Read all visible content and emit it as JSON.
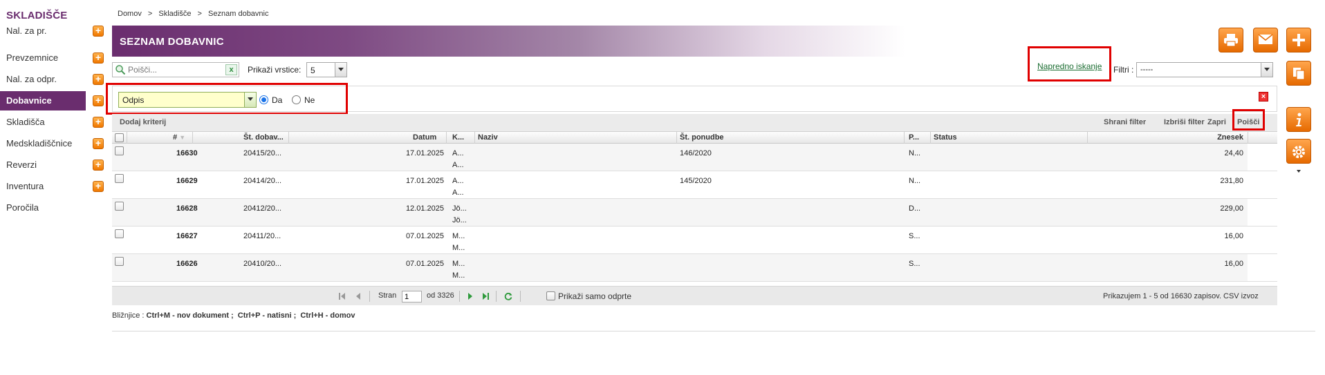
{
  "sidebar": {
    "title": "SKLADIŠČE",
    "items": [
      {
        "label": "Nal. za pr.",
        "add": true
      },
      {
        "label": "Prevzemnice",
        "add": true
      },
      {
        "label": "Nal. za odpr.",
        "add": true
      },
      {
        "label": "Dobavnice",
        "add": true,
        "active": true
      },
      {
        "label": "Skladišča",
        "add": true
      },
      {
        "label": "Medskladiščnice",
        "add": true
      },
      {
        "label": "Reverzi",
        "add": true
      },
      {
        "label": "Inventura",
        "add": true
      },
      {
        "label": "Poročila",
        "add": false
      }
    ]
  },
  "breadcrumb": [
    "Domov",
    ">",
    "Skladišče",
    ">",
    "Seznam dobavnic"
  ],
  "header": {
    "title": "SEZNAM DOBAVNIC"
  },
  "search": {
    "placeholder": "Poišči...",
    "clear_icon": "x"
  },
  "rows": {
    "label": "Prikaži vrstice:",
    "value": "5"
  },
  "advanced": {
    "label": "Napredno iskanje"
  },
  "filters": {
    "label": "Filtri :",
    "value": "-----"
  },
  "criteria": {
    "field_value": "Odpis",
    "option_yes": "Da",
    "option_no": "Ne",
    "selected": "Da"
  },
  "toolbar": {
    "add_criteria": "Dodaj kriterij",
    "save_filter": "Shrani filter",
    "delete_filter": "Izbriši filter",
    "close": "Zapri",
    "search": "Poišči"
  },
  "table": {
    "headers": {
      "num": "#",
      "doc_no": "Št. dobav...",
      "date": "Datum",
      "k": "K...",
      "name": "Naziv",
      "offer_no": "Št. ponudbe",
      "p": "P...",
      "status": "Status",
      "amount": "Znesek"
    },
    "rows": [
      {
        "num": "16630",
        "doc_no": "20415/20...",
        "date": "17.01.2025",
        "k1": "A...",
        "k2": "A...",
        "offer_no": "146/2020",
        "p": "N...",
        "amount": "24,40"
      },
      {
        "num": "16629",
        "doc_no": "20414/20...",
        "date": "17.01.2025",
        "k1": "A...",
        "k2": "A...",
        "offer_no": "145/2020",
        "p": "N...",
        "amount": "231,80"
      },
      {
        "num": "16628",
        "doc_no": "20412/20...",
        "date": "12.01.2025",
        "k1": "Jö...",
        "k2": "Jö...",
        "offer_no": "",
        "p": "D...",
        "amount": "229,00"
      },
      {
        "num": "16627",
        "doc_no": "20411/20...",
        "date": "07.01.2025",
        "k1": "M...",
        "k2": "M...",
        "offer_no": "",
        "p": "S...",
        "amount": "16,00"
      },
      {
        "num": "16626",
        "doc_no": "20410/20...",
        "date": "07.01.2025",
        "k1": "M...",
        "k2": "M...",
        "offer_no": "",
        "p": "S...",
        "amount": "16,00"
      }
    ]
  },
  "pager": {
    "page_label": "Stran",
    "page_value": "1",
    "of_label": "od 3326",
    "only_open_label": "Prikaži samo odprte",
    "status": "Prikazujem 1 - 5 od 16630 zapisov.",
    "csv": "CSV izvoz"
  },
  "shortcuts": {
    "label": "Bližnjice :",
    "items": [
      "Ctrl+M - nov dokument ;",
      "Ctrl+P - natisni ;",
      "Ctrl+H - domov"
    ]
  },
  "colors": {
    "brand": "#6a2d6e",
    "accent": "#f07800",
    "highlight": "#e00000"
  }
}
